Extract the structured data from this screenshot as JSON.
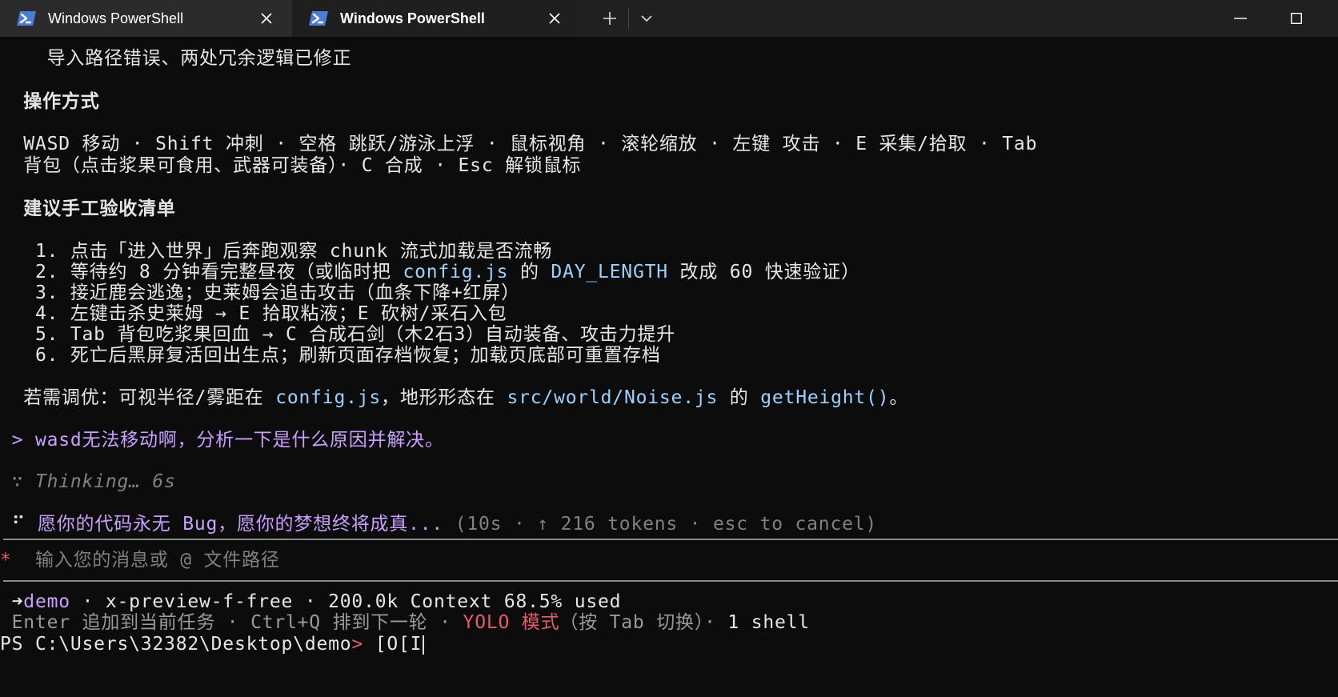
{
  "tabs": [
    {
      "label": "Windows PowerShell",
      "active": false
    },
    {
      "label": "Windows PowerShell",
      "active": true
    }
  ],
  "icons": {
    "tab_icon": "powershell-icon",
    "tab_close": "close-icon",
    "new_tab": "plus-icon",
    "dropdown": "chevron-down-icon",
    "minimize": "minimize-icon",
    "maximize": "maximize-icon"
  },
  "colors": {
    "background": "#0c0c0c",
    "accent_blue": "#9bd1ff",
    "accent_purple": "#c9a0ff",
    "yolo_red": "#e25c6a"
  },
  "output": {
    "fix_summary": "    导入路径错误、两处冗余逻辑已修正",
    "controls_title": "  操作方式",
    "controls_line1": "  WASD 移动 · Shift 冲刺 · 空格 跳跃/游泳上浮 · 鼠标视角 · 滚轮缩放 · 左键 攻击 · E 采集/拾取 · Tab",
    "controls_line2": "  背包（点击浆果可食用、武器可装备）· C 合成 · Esc 解锁鼠标",
    "checklist_title": "  建议手工验收清单",
    "checklist": {
      "item1": "   1. 点击「进入世界」后奔跑观察 chunk 流式加载是否流畅",
      "item2_pre": "   2. 等待约 8 分钟看完整昼夜（或临时把 ",
      "item2_code1": "config.js",
      "item2_mid": " 的 ",
      "item2_code2": "DAY_LENGTH",
      "item2_post": " 改成 60 快速验证）",
      "item3": "   3. 接近鹿会逃逸；史莱姆会追击攻击（血条下降+红屏）",
      "item4": "   4. 左键击杀史莱姆 → E 拾取粘液；E 砍树/采石入包",
      "item5": "   5. Tab 背包吃浆果回血 → C 合成石剑（木2石3）自动装备、攻击力提升",
      "item6": "   6. 死亡后黑屏复活回出生点；刷新页面存档恢复；加载页底部可重置存档"
    },
    "tuning": {
      "pre": "  若需调优：可视半径/雾距在 ",
      "code1": "config.js",
      "mid1": "，地形形态在 ",
      "code2": "src/world/Noise.js",
      "mid2": " 的 ",
      "code3": "getHeight()",
      "post": "。"
    }
  },
  "prompt_history": {
    "marker": " > ",
    "text": "wasd无法移动啊，分析一下是什么原因并解决。"
  },
  "thinking": {
    "marker": " ∵ ",
    "text": "Thinking… 6s"
  },
  "status": {
    "marker": " ⠋ ",
    "message": "愿你的代码永无 Bug，愿你的梦想终将成真...",
    "meta": " (10s · ↑ 216 tokens · esc to cancel)"
  },
  "input": {
    "marker": "*",
    "placeholder": "  输入您的消息或 @ 文件路径"
  },
  "footer": {
    "arrow": " ➜",
    "project": "demo",
    "model_info": " · x-preview-f-free · 200.0k Context 68.5% used",
    "hint_pre": " Enter 追加到当前任务 · Ctrl+Q 排到下一轮 · ",
    "yolo": "YOLO 模式",
    "hint_post": "（按 Tab 切换）· ",
    "shell_count": "1 shell"
  },
  "shell": {
    "prompt": "PS C:\\Users\\32382\\Desktop\\demo",
    "prompt_symbol": ">",
    "input": " [O[I"
  }
}
